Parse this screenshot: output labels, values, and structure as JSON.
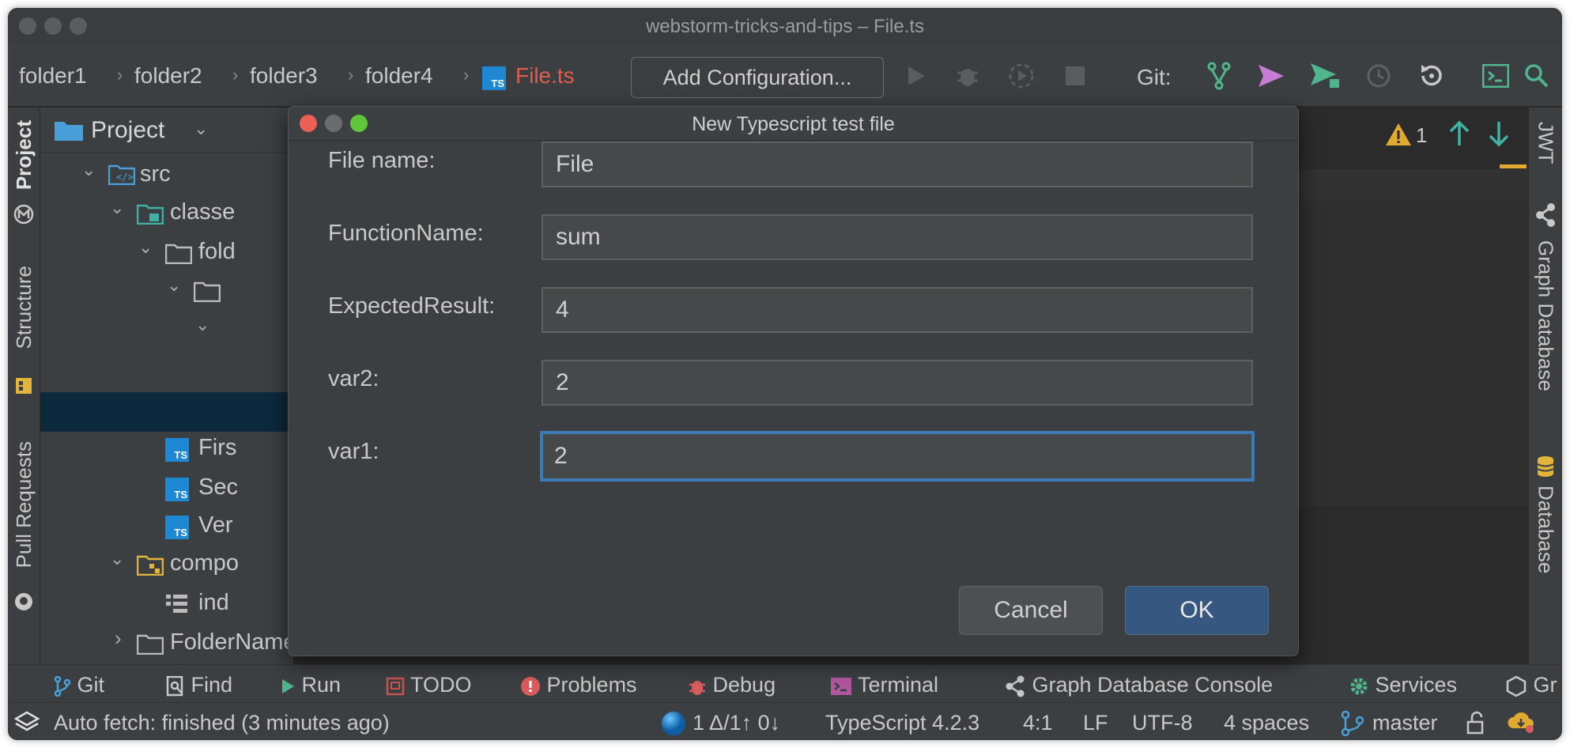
{
  "window": {
    "title": "webstorm-tricks-and-tips – File.ts"
  },
  "navbar": {
    "breadcrumbs": [
      "folder1",
      "folder2",
      "folder3",
      "folder4"
    ],
    "current_file": "File.ts",
    "file_badge": "TS",
    "add_configuration": "Add Configuration...",
    "git_label": "Git:"
  },
  "left_tabs": {
    "project": "Project",
    "structure": "Structure",
    "pull_requests": "Pull Requests"
  },
  "right_tabs": {
    "jwt": "JWT",
    "graph_database": "Graph Database",
    "database": "Database"
  },
  "project_panel": {
    "header": "Project",
    "tree": [
      "src",
      "classe",
      "fold",
      "Firs",
      "Sec",
      "Ver",
      "compo",
      "ind",
      "FolderName"
    ]
  },
  "editor": {
    "warning_count": "1"
  },
  "dialog": {
    "title": "New Typescript test file",
    "fields": [
      {
        "label": "File name:",
        "value": "File"
      },
      {
        "label": "FunctionName:",
        "value": "sum"
      },
      {
        "label": "ExpectedResult:",
        "value": "4"
      },
      {
        "label": "var2:",
        "value": "2"
      },
      {
        "label": "var1:",
        "value": "2"
      }
    ],
    "cancel": "Cancel",
    "ok": "OK"
  },
  "tool_windows": [
    "Git",
    "Find",
    "Run",
    "TODO",
    "Problems",
    "Debug",
    "Terminal",
    "Graph Database Console",
    "Services",
    "Gr"
  ],
  "status": {
    "message": "Auto fetch: finished (3 minutes ago)",
    "vcs_counts": "1 Δ/1↑ 0↓",
    "language": "TypeScript 4.2.3",
    "position": "4:1",
    "line_sep": "LF",
    "encoding": "UTF-8",
    "indent": "4 spaces",
    "branch": "master"
  },
  "colors": {
    "accent_blue": "#3d7ab8",
    "ok_button": "#365880",
    "error_red": "#e45b4d",
    "ts_blue": "#1e88d2"
  }
}
